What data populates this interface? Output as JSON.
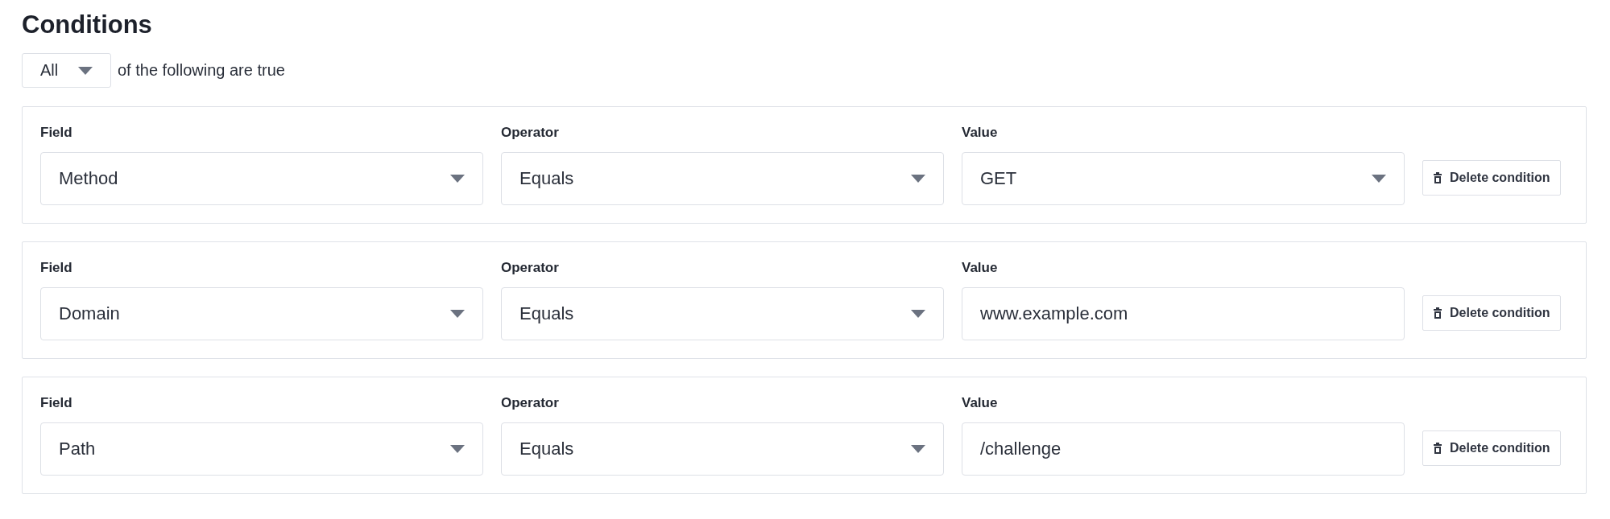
{
  "title": "Conditions",
  "match": {
    "value": "All",
    "suffix": "of the following are true"
  },
  "conditions": [
    {
      "field": {
        "label": "Field",
        "value": "Method"
      },
      "operator": {
        "label": "Operator",
        "value": "Equals"
      },
      "value": {
        "label": "Value",
        "value": "GET",
        "kind": "select"
      },
      "delete_label": "Delete condition"
    },
    {
      "field": {
        "label": "Field",
        "value": "Domain"
      },
      "operator": {
        "label": "Operator",
        "value": "Equals"
      },
      "value": {
        "label": "Value",
        "value": "www.example.com",
        "kind": "text"
      },
      "delete_label": "Delete condition"
    },
    {
      "field": {
        "label": "Field",
        "value": "Path"
      },
      "operator": {
        "label": "Operator",
        "value": "Equals"
      },
      "value": {
        "label": "Value",
        "value": "/challenge",
        "kind": "text"
      },
      "delete_label": "Delete condition"
    }
  ]
}
